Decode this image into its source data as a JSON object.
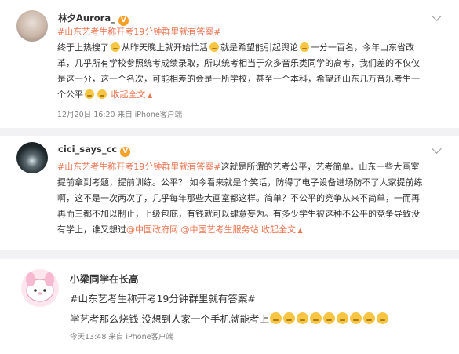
{
  "posts": [
    {
      "username": "林夕Aurora_",
      "topic": "#山东艺考生称开考19分钟群里就有答案#",
      "body": {
        "l1a": "终于上热搜了",
        "l1b": "从昨天晚上就开始忙活",
        "l1c": "就是希望能引起舆论",
        "l1d": "一分一百名，今年山东省改",
        "l2": "革，几乎所有学校参照统考成绩录取，所以统考相当于众多音乐类同学的高考，我们差的不仅仅",
        "l3": "是这一分，这一个名次，可能相差的会是一所学校，甚至一个本科，希望还山东几万音乐考生一",
        "l4a": "个公平",
        "collapse": "收起全文"
      },
      "meta": "12月20日 16:20  来自 iPhone客户端"
    },
    {
      "username": "cici_says_cc",
      "topic": "#山东艺考生称开考19分钟群里就有答案#",
      "body": {
        "l1": "这就是所谓的艺考公平，艺考简单。山东一些大画室",
        "l2": "提前拿到考题，提前训练。公平？ 如今看来就是个笑话，防得了电子设备进场防不了人家提前练",
        "l3": "啊，这不是一次两次了，几乎每年那些大画室都这样。简单？不公平的竞争从来不简单，一而再",
        "l4": "再而三都不加以制止，上级包庇，有钱就可以肆意妄为。有多少学生被这种不公平的竞争导致没",
        "l5a": "有学上，谁又想过",
        "mention1": "@中国政府网",
        "mention2": "@中国艺考生服务站",
        "collapse": "收起全文"
      }
    },
    {
      "username": "小梁同学在长高",
      "topic": "#山东艺考生称开考19分钟群里就有答案#",
      "body": "学艺考那么烧钱 没想到人家一个手机就能考上",
      "meta": "今天13:48  来自 iPhone客户端"
    }
  ],
  "icons": {
    "emoji": "sad-face-emoji",
    "more": "chevron-down-icon",
    "collapse": "collapse-arrow-icon"
  },
  "colors": {
    "link": "#eb7350",
    "badge": "#f7a128",
    "divider": "#f2f2f5"
  }
}
